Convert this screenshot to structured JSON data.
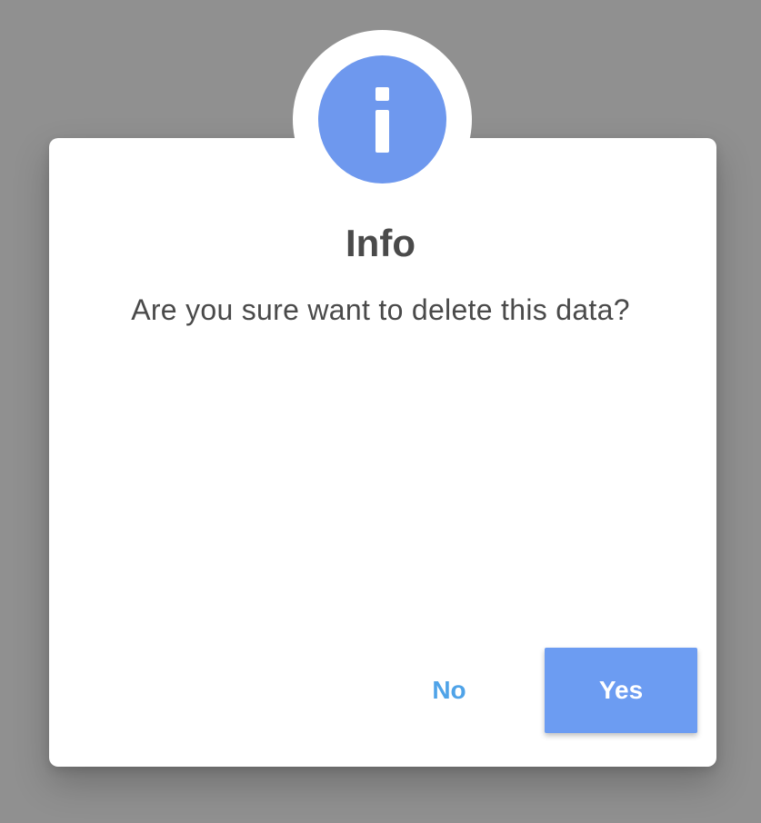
{
  "dialog": {
    "icon": "info-icon",
    "title": "Info",
    "message": "Are you sure want to delete this data?",
    "no_label": "No",
    "yes_label": "Yes"
  },
  "colors": {
    "accent": "#6e98ee",
    "primary_button": "#6c9cf2",
    "secondary_text": "#4fa3e8",
    "overlay": "#909090",
    "text": "#4a4a4a"
  }
}
